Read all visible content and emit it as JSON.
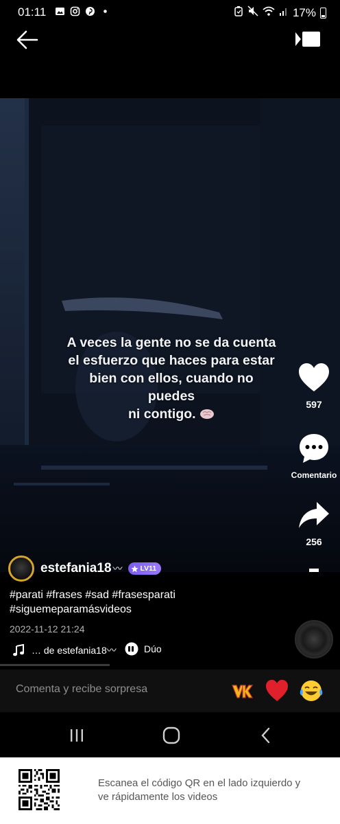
{
  "status_bar": {
    "time": "01:11",
    "battery": "17%",
    "notification_icons": [
      "gallery-icon",
      "instagram-icon",
      "pinterest-icon",
      "dot-icon"
    ],
    "system_icons": [
      "alarm-icon",
      "mute-icon",
      "wifi-icon",
      "signal-icon",
      "battery-icon"
    ]
  },
  "top_bar": {
    "back_icon": "arrow-left-icon",
    "cast_icon": "video-cast-icon"
  },
  "video": {
    "caption_lines": [
      "A veces la gente no se da cuenta",
      "el esfuerzo que haces para estar",
      "bien con ellos, cuando no puedes",
      "ni contigo."
    ],
    "caption_emoji": "brain-emoji"
  },
  "actions": {
    "like_count": "597",
    "comment_label": "Comentario",
    "share_count": "256"
  },
  "post": {
    "author": "estefania18",
    "author_suffix": "〰",
    "level_badge": "LV11",
    "hashtags_line1": "#parati #frases #sad #frasesparati",
    "hashtags_line2": "#siguemeparamásvideos",
    "timestamp": "2022-11-12 21:24",
    "music_text": "… de estefania18〰",
    "duo_label": "Dúo"
  },
  "comment_bar": {
    "placeholder": "Comenta y recibe sorpresa",
    "quick_emojis": [
      "kwai-sticker-icon",
      "red-heart-icon",
      "laughing-tears-icon"
    ]
  },
  "footer": {
    "text": "Escanea el código QR en el lado izquierdo y ve rápidamente los videos"
  },
  "colors": {
    "accent_level": "#8a6af4",
    "heart_red": "#e0202a",
    "avatar_ring": "#d7a52c"
  }
}
